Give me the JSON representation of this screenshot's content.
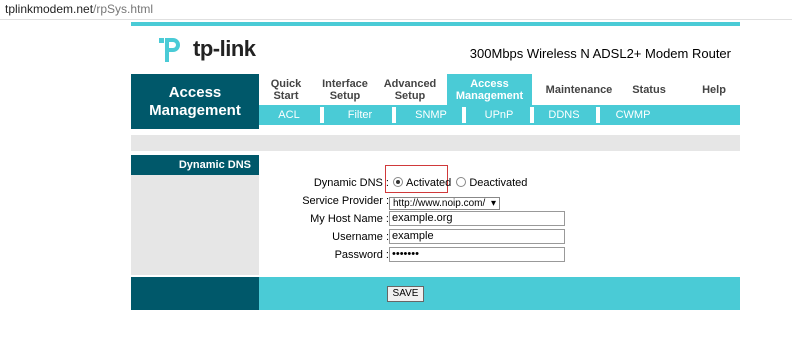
{
  "browser": {
    "url_host": "tplinkmodem.net",
    "url_path": "/rpSys.html"
  },
  "header": {
    "logo_text": "tp-link",
    "product": "300Mbps Wireless N ADSL2+ Modem Router"
  },
  "nav": {
    "section_line1": "Access",
    "section_line2": "Management",
    "tabs": [
      {
        "l1": "Quick",
        "l2": "Start"
      },
      {
        "l1": "Interface",
        "l2": "Setup"
      },
      {
        "l1": "Advanced",
        "l2": "Setup"
      },
      {
        "l1": "Access",
        "l2": "Management"
      },
      {
        "l1": "Maintenance",
        "l2": ""
      },
      {
        "l1": "Status",
        "l2": ""
      },
      {
        "l1": "Help",
        "l2": ""
      }
    ],
    "subtabs": [
      "ACL",
      "Filter",
      "SNMP",
      "UPnP",
      "DDNS",
      "CWMP"
    ]
  },
  "ddns": {
    "section": "Dynamic DNS",
    "dyn_label": "Dynamic DNS :",
    "activated": "Activated",
    "deactivated": "Deactivated",
    "provider_label": "Service Provider :",
    "provider_value": "http://www.noip.com/",
    "host_label": "My Host Name :",
    "host_value": "example.org",
    "user_label": "Username :",
    "user_value": "example",
    "pass_label": "Password :",
    "pass_value": "•••••••",
    "save": "SAVE"
  },
  "colors": {
    "accent": "#4acbd6",
    "dark": "#00586a",
    "gray": "#e6e6e6"
  }
}
